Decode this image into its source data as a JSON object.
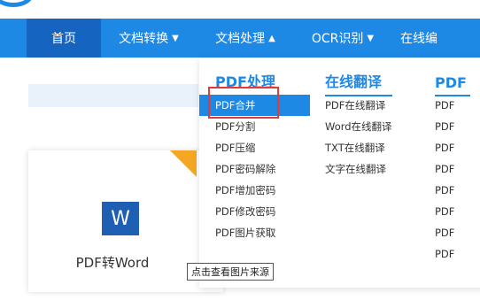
{
  "nav": {
    "items": [
      {
        "label": "首页"
      },
      {
        "label": "文档转换",
        "caret": "▼"
      },
      {
        "label": "文档处理",
        "caret": "▲"
      },
      {
        "label": "OCR识别",
        "caret": "▼"
      },
      {
        "label": "在线编"
      }
    ]
  },
  "card": {
    "icon_letter": "W",
    "title": "PDF转Word"
  },
  "dropdown": {
    "col1": {
      "title": "PDF处理",
      "items": [
        "PDF合并",
        "PDF分割",
        "PDF压缩",
        "PDF密码解除",
        "PDF增加密码",
        "PDF修改密码",
        "PDF图片获取"
      ]
    },
    "col2": {
      "title": "在线翻译",
      "items": [
        "PDF在线翻译",
        "Word在线翻译",
        "TXT在线翻译",
        "文字在线翻译"
      ]
    },
    "col3": {
      "title": "PDF",
      "items": [
        "PDF",
        "PDF",
        "PDF",
        "PDF",
        "PDF",
        "PDF",
        "PDF",
        "PDF"
      ]
    }
  },
  "tooltip": {
    "text": "点击查看图片来源"
  },
  "colors": {
    "nav_bg": "#1e88e5",
    "nav_active": "#1565c0",
    "accent": "#1e88e5",
    "highlight": "#e53935"
  }
}
